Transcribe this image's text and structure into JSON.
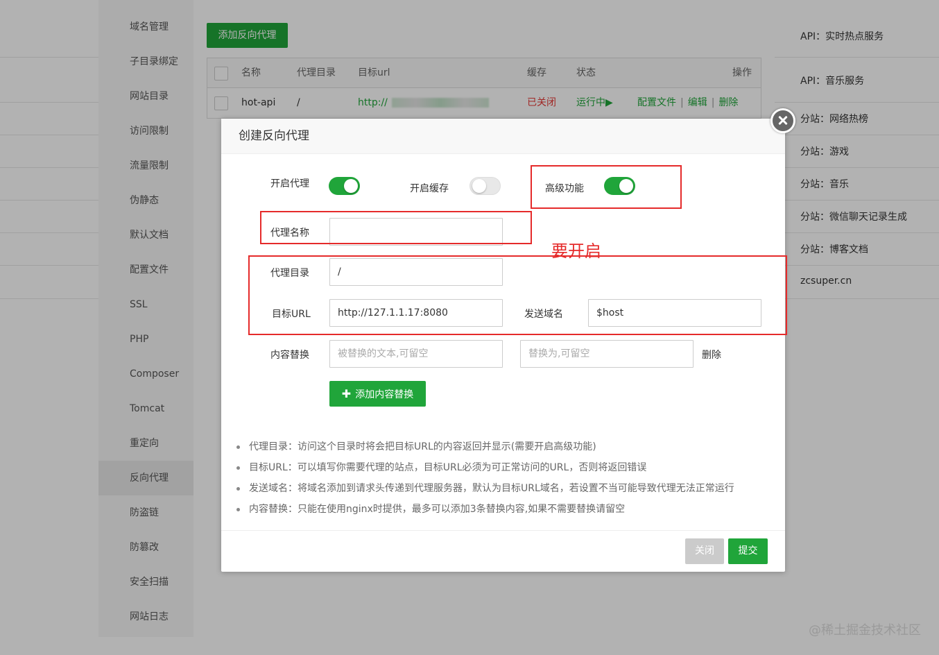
{
  "right_list": [
    "API：实时热点服务",
    "API：音乐服务",
    "分站：网络热榜",
    "分站：游戏",
    "分站：音乐",
    "分站：微信聊天记录生成",
    "分站：博客文档",
    "zcsuper.cn"
  ],
  "side_menu": [
    "域名管理",
    "子目录绑定",
    "网站目录",
    "访问限制",
    "流量限制",
    "伪静态",
    "默认文档",
    "配置文件",
    "SSL",
    "PHP",
    "Composer",
    "Tomcat",
    "重定向",
    "反向代理",
    "防盗链",
    "防篡改",
    "安全扫描",
    "网站日志"
  ],
  "active_menu": "反向代理",
  "add_proxy_button": "添加反向代理",
  "table": {
    "headers": [
      "名称",
      "代理目录",
      "目标url",
      "缓存",
      "状态",
      "操作"
    ],
    "row": {
      "name": "hot-api",
      "dir": "/",
      "url": "http://",
      "cache": "已关闭",
      "status": "运行中▶",
      "config": "配置文件",
      "edit": "编辑",
      "delete": "删除"
    }
  },
  "modal": {
    "title": "创建反向代理",
    "enable_proxy_label": "开启代理",
    "enable_cache_label": "开启缓存",
    "advanced_label": "高级功能",
    "enable_proxy": true,
    "enable_cache": false,
    "advanced": true,
    "proxy_name_label": "代理名称",
    "proxy_name_value": "",
    "proxy_dir_label": "代理目录",
    "proxy_dir_value": "/",
    "target_url_label": "目标URL",
    "target_url_value": "http://127.1.1.17:8080",
    "send_domain_label": "发送域名",
    "send_domain_value": "$host",
    "replace_label": "内容替换",
    "replace_from_placeholder": "被替换的文本,可留空",
    "replace_to_placeholder": "替换为,可留空",
    "replace_delete": "删除",
    "add_replace_button": "添加内容替换",
    "notes": [
      "代理目录：访问这个目录时将会把目标URL的内容返回并显示(需要开启高级功能)",
      "目标URL：可以填写你需要代理的站点，目标URL必须为可正常访问的URL，否则将返回错误",
      "发送域名：将域名添加到请求头传递到代理服务器，默认为目标URL域名，若设置不当可能导致代理无法正常运行",
      "内容替换：只能在使用nginx时提供，最多可以添加3条替换内容,如果不需要替换请留空"
    ],
    "close_button": "关闭",
    "submit_button": "提交"
  },
  "annotation": "要开启",
  "watermark": "@稀土掘金技术社区",
  "colors": {
    "accent_green": "#20a53a",
    "annotation_red": "#e52a2a"
  }
}
